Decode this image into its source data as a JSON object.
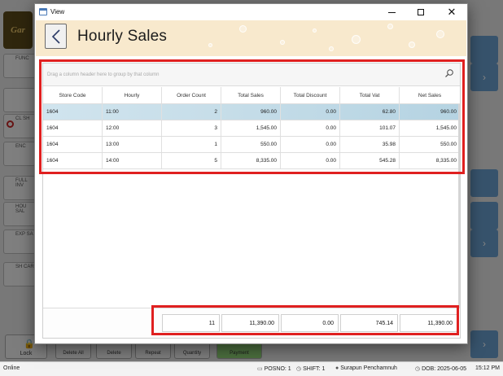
{
  "window": {
    "title": "View",
    "minimize_label": "—",
    "close_label": "✕"
  },
  "header": {
    "title": "Hourly Sales",
    "back_icon": "chevron-left-icon"
  },
  "grid": {
    "group_hint": "Drag a column header here to group by that column",
    "columns": [
      "Store Code",
      "Hourly",
      "Order Count",
      "Total Sales",
      "Total Discount",
      "Total Vat",
      "Net Sales"
    ],
    "rows": [
      [
        "1604",
        "11:00",
        "2",
        "960.00",
        "0.00",
        "62.80",
        "960.00"
      ],
      [
        "1604",
        "12:00",
        "3",
        "1,545.00",
        "0.00",
        "101.07",
        "1,545.00"
      ],
      [
        "1604",
        "13:00",
        "1",
        "550.00",
        "0.00",
        "35.98",
        "550.00"
      ],
      [
        "1604",
        "14:00",
        "5",
        "8,335.00",
        "0.00",
        "545.28",
        "8,335.00"
      ]
    ],
    "selected_row": 0,
    "totals": {
      "order_count": "11",
      "total_sales": "11,390.00",
      "total_discount": "0.00",
      "total_vat": "745.14",
      "net_sales": "11,390.00"
    }
  },
  "background": {
    "left_buttons": [
      "FUNC",
      "",
      "CL SH",
      "ENC",
      "FULL INV",
      "HOU SAL",
      "EXP SA",
      "SH CAR"
    ],
    "bottom_buttons": [
      "Lock",
      "Delete All",
      "Delete",
      "Repeat",
      "Quantity",
      "Payment"
    ],
    "logo_text": "Gar"
  },
  "statusbar": {
    "connection": "Online",
    "posno": "POSNO: 1",
    "shift": "SHIFT: 1",
    "user": "Surapun Penchamnuh",
    "dob": "DOB: 2025-06-05",
    "time": "15:12 PM"
  },
  "colors": {
    "header_bg": "#f8e9cd",
    "selected_row": "#c7dee9",
    "highlight": "#e02020"
  }
}
